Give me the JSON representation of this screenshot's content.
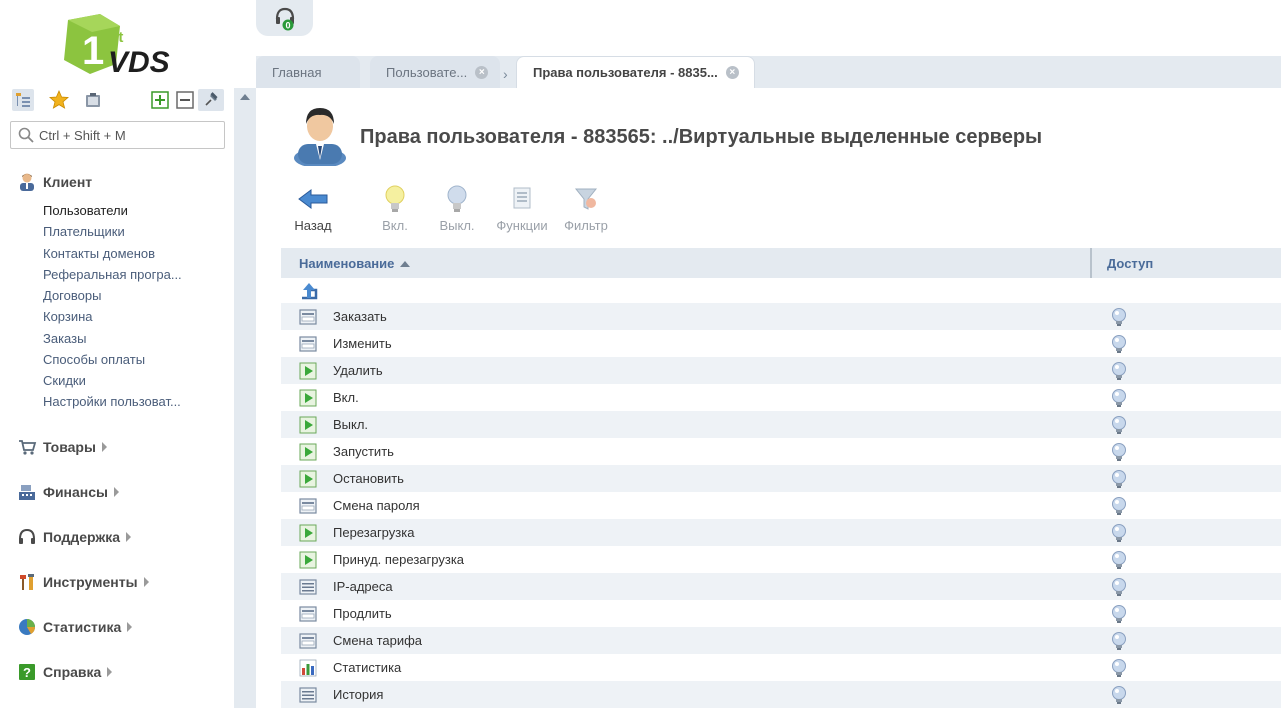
{
  "brand": {
    "logo_text": "VDS",
    "logo_super": "st",
    "logo_digit": "1",
    "color_green": "#8cc43f",
    "color_dark": "#1e1e1e"
  },
  "sidebar": {
    "search_placeholder": "Ctrl + Shift + M",
    "toolbar_icons": [
      "tree-icon",
      "star-icon",
      "clipboard-icon",
      "expand-icon",
      "collapse-icon",
      "pin-icon"
    ],
    "client": {
      "label": "Клиент",
      "items": [
        "Пользователи",
        "Плательщики",
        "Контакты доменов",
        "Реферальная програ...",
        "Договоры",
        "Корзина",
        "Заказы",
        "Способы оплаты",
        "Скидки",
        "Настройки пользоват..."
      ]
    },
    "groups": [
      {
        "label": "Товары",
        "icon": "cart-icon"
      },
      {
        "label": "Финансы",
        "icon": "cash-register-icon"
      },
      {
        "label": "Поддержка",
        "icon": "headset-icon"
      },
      {
        "label": "Инструменты",
        "icon": "tools-icon"
      },
      {
        "label": "Статистика",
        "icon": "pie-chart-icon"
      },
      {
        "label": "Справка",
        "icon": "help-icon"
      }
    ]
  },
  "topbar": {
    "support_badge": "0"
  },
  "tabs": [
    {
      "label": "Главная"
    },
    {
      "label": "Пользовате..."
    },
    {
      "label": "Права пользователя - 8835..."
    }
  ],
  "main": {
    "title": "Права пользователя - 883565: ../Виртуальные выделенные серверы",
    "actions": [
      {
        "label": "Назад",
        "icon": "back-arrow-icon",
        "enabled": true
      },
      {
        "label": "Вкл.",
        "icon": "bulb-on-icon",
        "enabled": false
      },
      {
        "label": "Выкл.",
        "icon": "bulb-off-icon",
        "enabled": false
      },
      {
        "label": "Функции",
        "icon": "functions-icon",
        "enabled": false
      },
      {
        "label": "Фильтр",
        "icon": "filter-icon",
        "enabled": false
      }
    ],
    "grid": {
      "col_name": "Наименование",
      "col_access": "Доступ",
      "rows": [
        {
          "name": "Заказать",
          "icon": "form-icon"
        },
        {
          "name": "Изменить",
          "icon": "form-icon"
        },
        {
          "name": "Удалить",
          "icon": "play-icon"
        },
        {
          "name": "Вкл.",
          "icon": "play-icon"
        },
        {
          "name": "Выкл.",
          "icon": "play-icon"
        },
        {
          "name": "Запустить",
          "icon": "play-icon"
        },
        {
          "name": "Остановить",
          "icon": "play-icon"
        },
        {
          "name": "Смена пароля",
          "icon": "form-icon"
        },
        {
          "name": "Перезагрузка",
          "icon": "play-icon"
        },
        {
          "name": "Принуд. перезагрузка",
          "icon": "play-icon"
        },
        {
          "name": "IP-адреса",
          "icon": "list-icon"
        },
        {
          "name": "Продлить",
          "icon": "form-icon"
        },
        {
          "name": "Смена тарифа",
          "icon": "form-icon"
        },
        {
          "name": "Статистика",
          "icon": "bar-chart-icon"
        },
        {
          "name": "История",
          "icon": "list-icon"
        }
      ]
    }
  }
}
